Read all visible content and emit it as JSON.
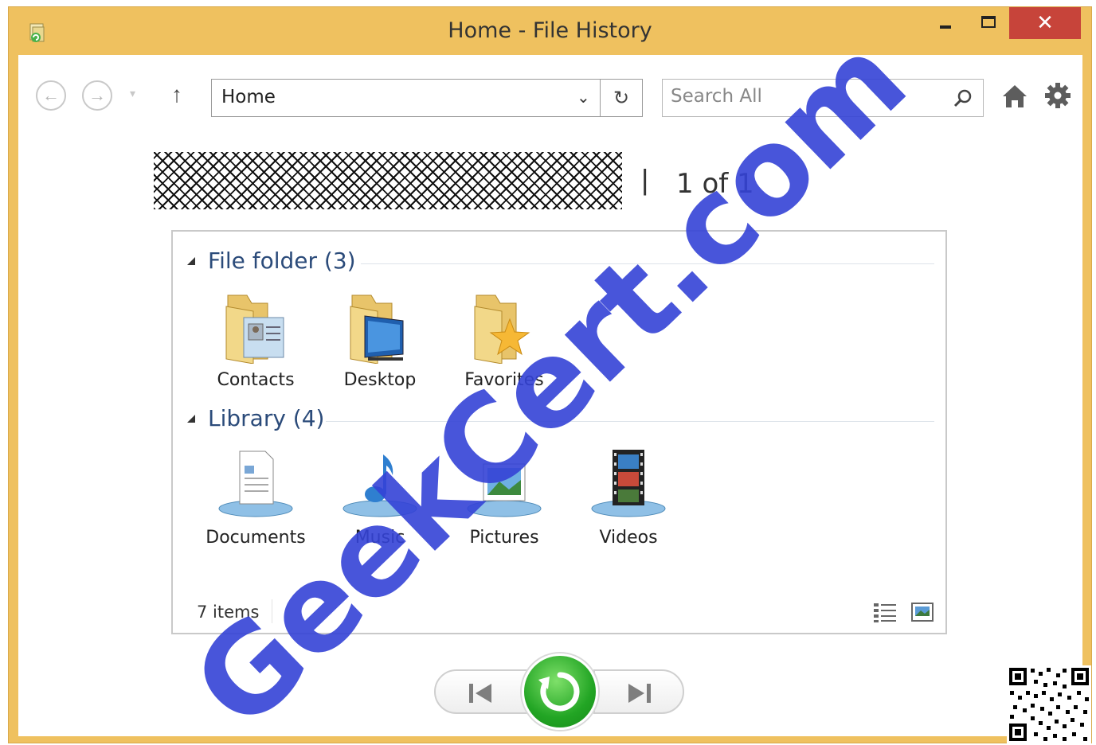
{
  "window": {
    "title": "Home - File History",
    "close_glyph": "✕",
    "accent_color": "#efc15f",
    "close_color": "#c7443a"
  },
  "toolbar": {
    "back_glyph": "←",
    "forward_glyph": "→",
    "recent_glyph": "▾",
    "up_glyph": "↑",
    "address": "Home",
    "dropdown_glyph": "⌄",
    "refresh_glyph": "↻",
    "search_placeholder": "Search All"
  },
  "backup_bar": {
    "separator": "|",
    "page_count": "1 of 1"
  },
  "groups": [
    {
      "title": "File folder (3)",
      "items": [
        {
          "label": "Contacts",
          "icon": "contacts-folder-icon"
        },
        {
          "label": "Desktop",
          "icon": "desktop-folder-icon"
        },
        {
          "label": "Favorites",
          "icon": "favorites-folder-icon"
        }
      ]
    },
    {
      "title": "Library (4)",
      "items": [
        {
          "label": "Documents",
          "icon": "documents-library-icon"
        },
        {
          "label": "Music",
          "icon": "music-library-icon"
        },
        {
          "label": "Pictures",
          "icon": "pictures-library-icon"
        },
        {
          "label": "Videos",
          "icon": "videos-library-icon"
        }
      ]
    }
  ],
  "status": {
    "item_count": "7 items"
  },
  "overlay": {
    "watermark": "GeekCert.com"
  }
}
